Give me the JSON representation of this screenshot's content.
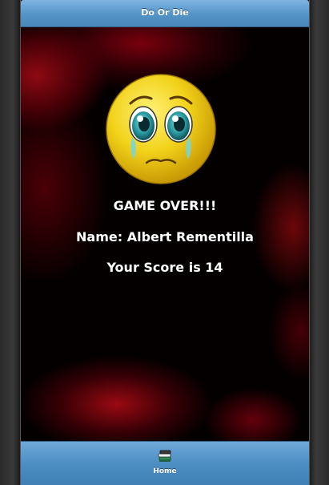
{
  "header": {
    "title": "Do Or Die"
  },
  "game_over": {
    "heading": "GAME OVER!!!",
    "name_line": "Name: Albert Rementilla",
    "score_line": "Your Score is 14"
  },
  "footer": {
    "home_label": "Home",
    "home_icon": "book-stack-icon"
  },
  "colors": {
    "header_bar": "#5393c5",
    "footer_bar": "#4d8fc4",
    "background": "#000000",
    "blood_red": "#8b0010",
    "face_yellow": "#f2d21a"
  }
}
